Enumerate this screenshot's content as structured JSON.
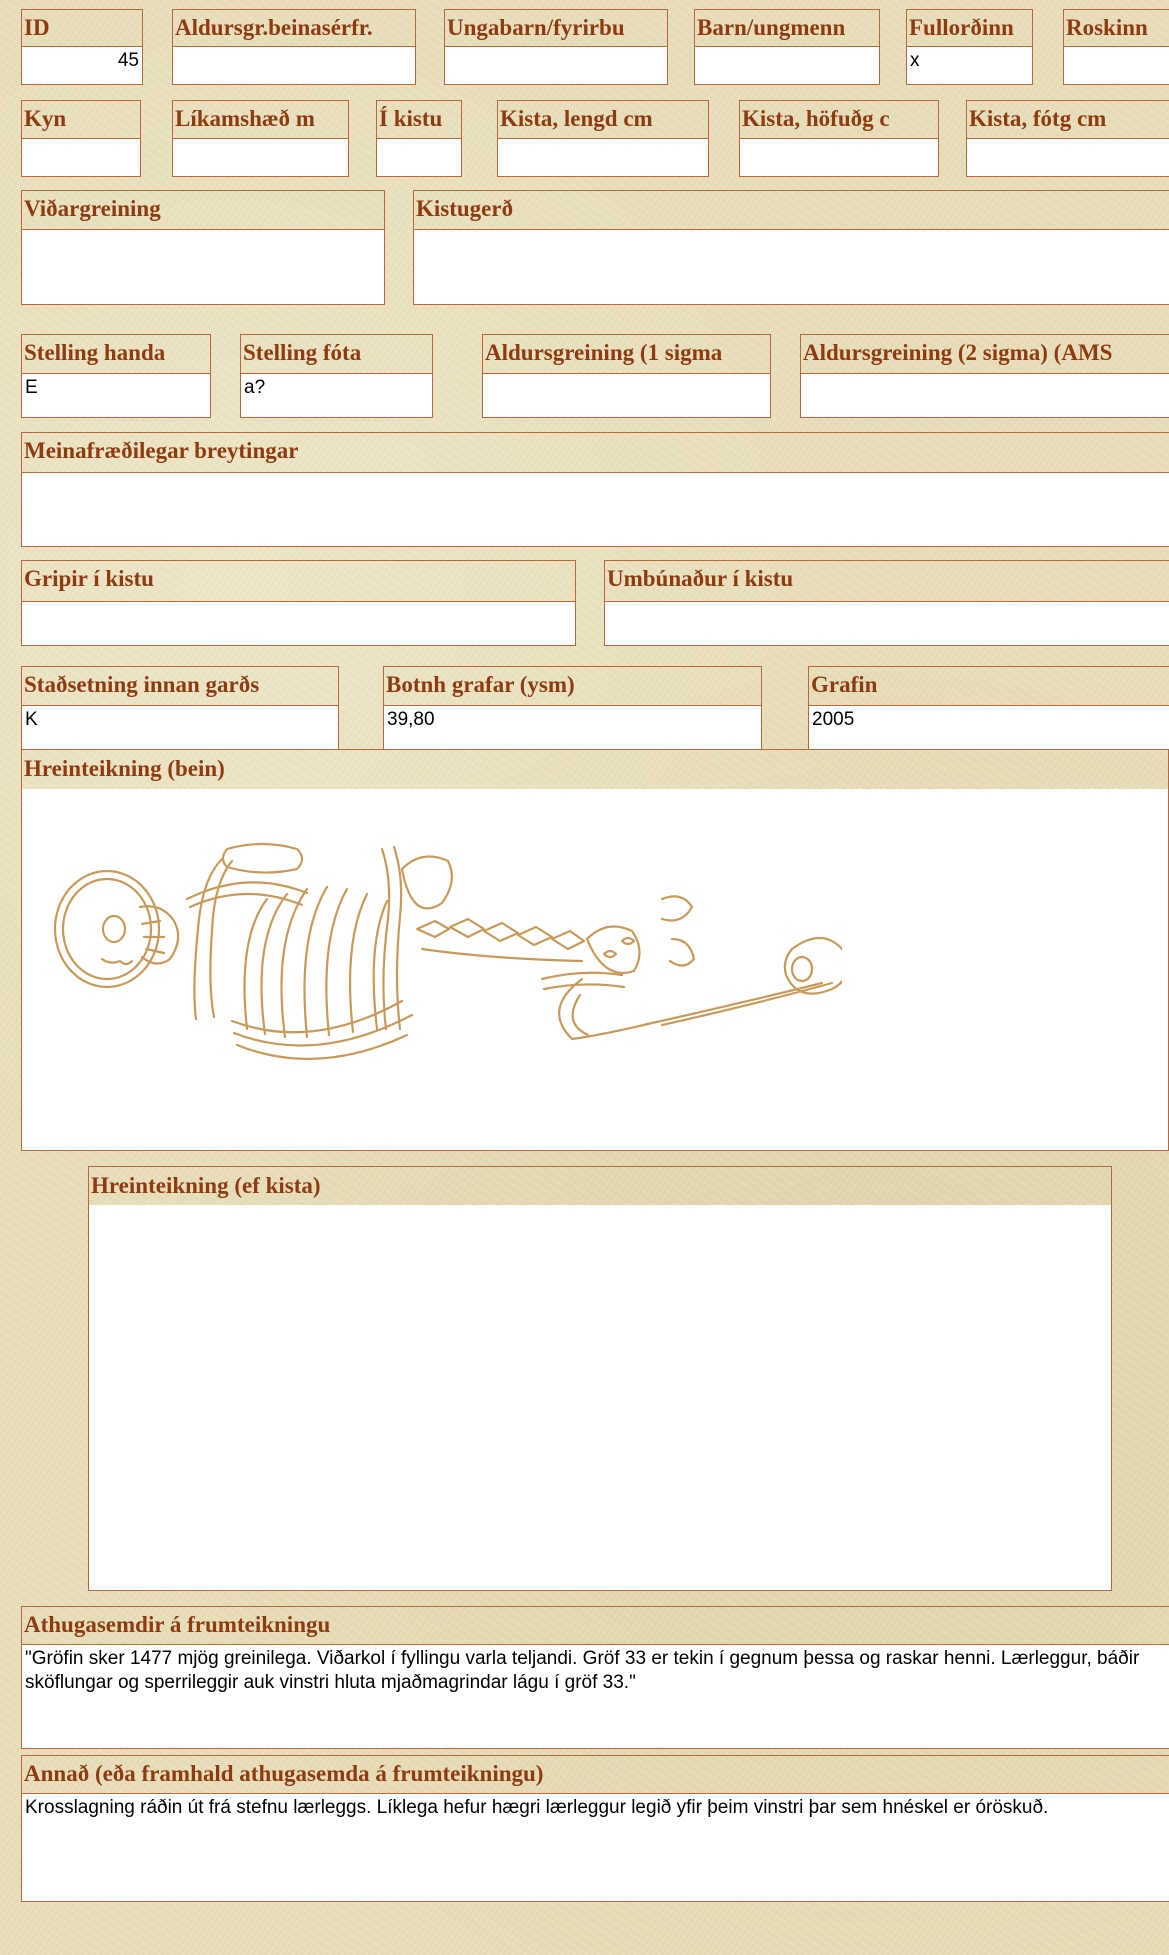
{
  "row1": {
    "id": {
      "label": "ID",
      "value": "45"
    },
    "aldur_beina": {
      "label": "Aldursgr.beinasérfr.",
      "value": ""
    },
    "ungabarn": {
      "label": "Ungabarn/fyrirbu",
      "value": ""
    },
    "barn": {
      "label": "Barn/ungmenn",
      "value": ""
    },
    "fullordinn": {
      "label": "Fullorðinn",
      "value": "x"
    },
    "roskinn": {
      "label": "Roskinn",
      "value": ""
    }
  },
  "row2": {
    "kyn": {
      "label": "Kyn",
      "value": ""
    },
    "likamshaed": {
      "label": "Líkamshæð m",
      "value": ""
    },
    "i_kistu": {
      "label": "Í kistu",
      "value": ""
    },
    "kista_lengd": {
      "label": "Kista, lengd cm",
      "value": ""
    },
    "kista_hofud": {
      "label": "Kista, höfuðg c",
      "value": ""
    },
    "kista_fotg": {
      "label": "Kista, fótg cm",
      "value": ""
    }
  },
  "row3": {
    "vidargreining": {
      "label": "Viðargreining",
      "value": ""
    },
    "kistugerd": {
      "label": "Kistugerð",
      "value": ""
    }
  },
  "row4": {
    "stelling_handa": {
      "label": "Stelling handa",
      "value": "E"
    },
    "stelling_fota": {
      "label": "Stelling fóta",
      "value": "a?"
    },
    "aldur_1sigma": {
      "label": "Aldursgreining (1 sigma",
      "value": ""
    },
    "aldur_2sigma": {
      "label": "Aldursgreining (2 sigma) (AMS",
      "value": ""
    }
  },
  "meinafraedi": {
    "label": "Meinafræðilegar breytingar",
    "value": ""
  },
  "row6": {
    "gripir": {
      "label": "Gripir í kistu",
      "value": ""
    },
    "umbunadur": {
      "label": "Umbúnaður í kistu",
      "value": ""
    }
  },
  "row7": {
    "stadsetning": {
      "label": "Staðsetning innan garðs",
      "value": "K"
    },
    "botnh": {
      "label": "Botnh grafar (ysm)",
      "value": "39,80"
    },
    "grafin": {
      "label": "Grafin",
      "value": "2005"
    }
  },
  "hreinteikning_bein": {
    "label": "Hreinteikning (bein)",
    "icon": "skeleton-drawing"
  },
  "hreinteikning_kista": {
    "label": "Hreinteikning (ef kista)"
  },
  "athugasemdir": {
    "label": "Athugasemdir á frumteikningu",
    "value": "\"Gröfin sker 1477 mjög greinilega. Viðarkol í fyllingu varla teljandi. Gröf 33 er tekin í gegnum þessa og raskar henni. Lærleggur, báðir sköflungar og sperrileggir auk vinstri hluta mjaðmagrindar lágu í gröf 33.\""
  },
  "annad": {
    "label": "Annað (eða framhald athugasemda á frumteikningu)",
    "value": "Krosslagning ráðin út frá stefnu lærleggs. Líklega hefur hægri lærleggur legið yfir þeim vinstri þar sem hnéskel er óröskuð."
  }
}
